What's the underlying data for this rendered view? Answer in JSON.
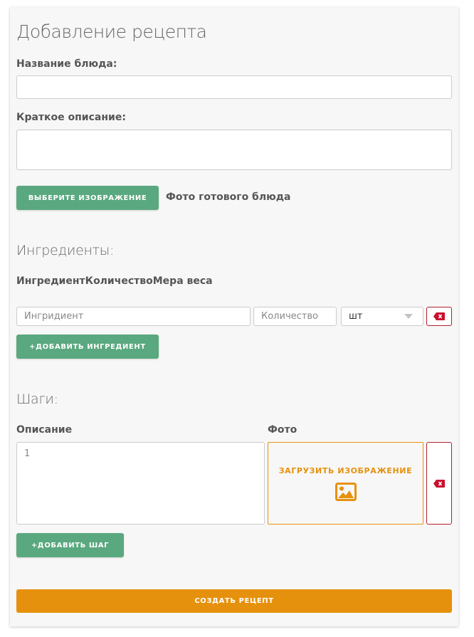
{
  "page_title": "Добавление рецепта",
  "dish_name": {
    "label": "Название блюда:",
    "value": ""
  },
  "short_description": {
    "label": "Краткое описание:",
    "value": ""
  },
  "image_picker": {
    "button_label": "ВЫБЕРИТЕ ИЗОБРАЖЕНИЕ",
    "caption": "Фото готового блюда"
  },
  "ingredients": {
    "title": "Ингредиенты:",
    "headers": "ИнгредиентКоличествоМера веса",
    "rows": [
      {
        "name_placeholder": "Ингридиент",
        "quantity_placeholder": "Количество",
        "unit": "шт"
      }
    ],
    "add_label": "+ДОБАВИТЬ ИНГРЕДИЕНТ"
  },
  "steps": {
    "title": "Шаги:",
    "description_header": "Описание",
    "photo_header": "Фото",
    "rows": [
      {
        "description": "1",
        "upload_label": "ЗАГРУЗИТЬ ИЗОБРАЖЕНИЕ"
      }
    ],
    "add_label": "+ДОБАВИТЬ ШАГ"
  },
  "submit_label": "СОЗДАТЬ РЕЦЕПТ",
  "colors": {
    "green": "#5aa87f",
    "orange": "#e6910d",
    "danger": "#b22030"
  },
  "icons": {
    "delete": "backspace-x-icon",
    "image": "image-icon",
    "dropdown": "caret-down-icon"
  }
}
